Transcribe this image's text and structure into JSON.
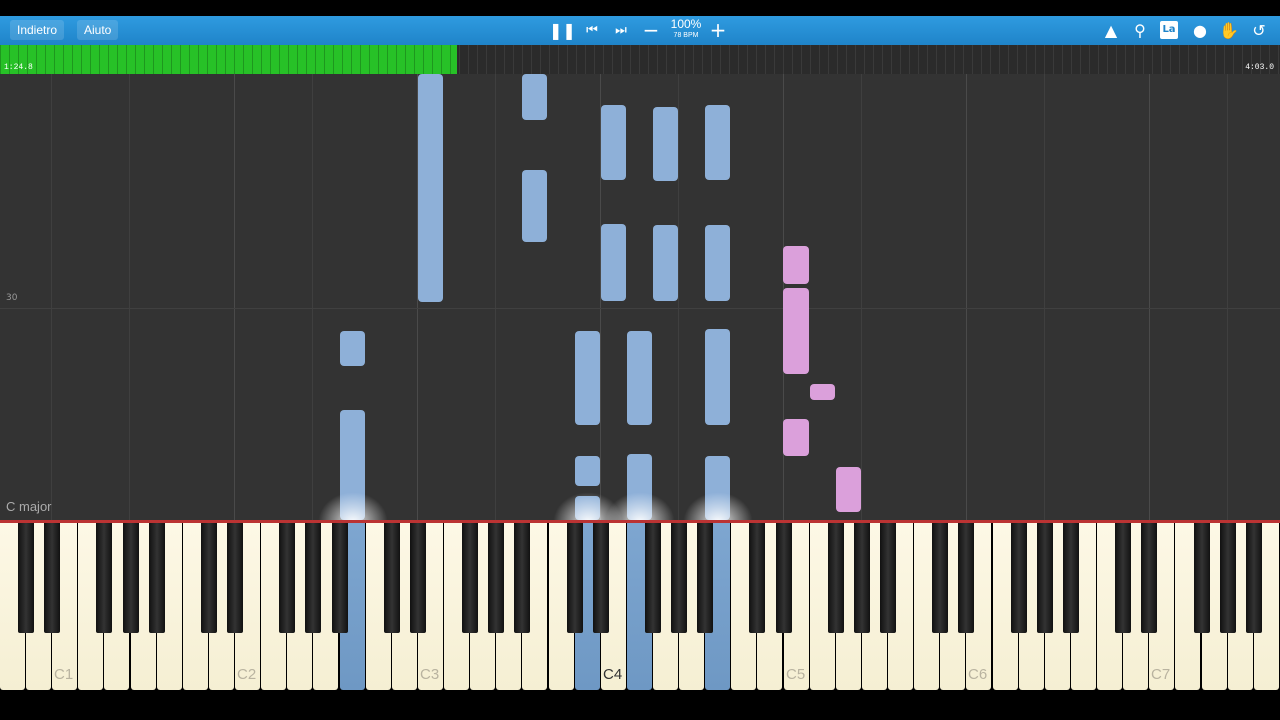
{
  "toolbar": {
    "back_label": "Indietro",
    "help_label": "Aiuto",
    "speed_percent": "100%",
    "bpm": "78 BPM",
    "key_label_icon_text": "La",
    "icons": [
      "pause-icon",
      "prev-icon",
      "next-icon",
      "minus-icon",
      "plus-icon",
      "metronome-icon",
      "search-icon",
      "key-label-icon",
      "marker-icon",
      "hand-icon",
      "loop-icon"
    ]
  },
  "progress": {
    "elapsed": "1:24.8",
    "total": "4:03.0",
    "fraction": 0.357
  },
  "roll": {
    "measure_number": "30",
    "key_signature": "C major"
  },
  "keyboard": {
    "c_labels": [
      "C1",
      "C2",
      "C3",
      "C4",
      "C5",
      "C6",
      "C7"
    ],
    "active_c_label": "C4"
  },
  "colors": {
    "left_hand": "#8eb0d8",
    "right_hand": "#dba0db",
    "progress": "#27c127",
    "toolbar": "#1f84c9"
  }
}
